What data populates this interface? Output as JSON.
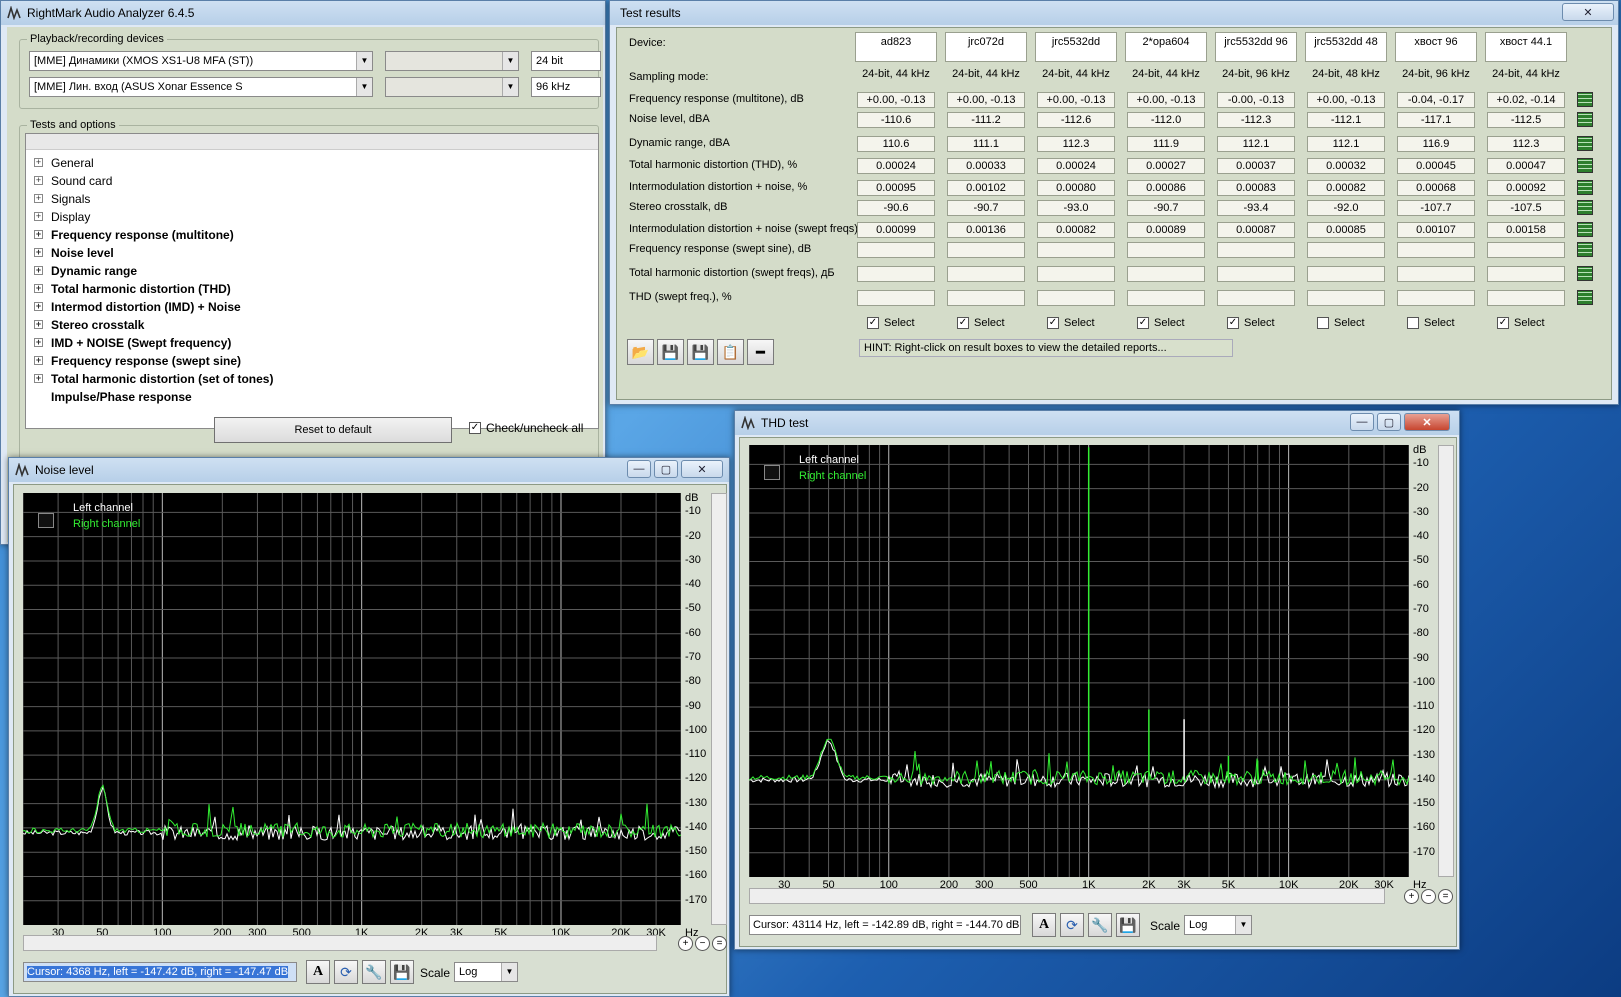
{
  "main": {
    "title": "RightMark Audio Analyzer 6.4.5",
    "playback_group": "Playback/recording devices",
    "playback_device": "[MME] Динамики (XMOS XS1-U8 MFA (ST))",
    "record_device": "[MME] Лин. вход (ASUS Xonar Essence S",
    "bits": "24 bit",
    "rate": "96 kHz",
    "tests_group": "Tests and options",
    "tree": [
      "General",
      "Sound card",
      "Signals",
      "Display",
      "Frequency response (multitone)",
      "Noise level",
      "Dynamic range",
      "Total harmonic distortion (THD)",
      "Intermod distortion (IMD) + Noise",
      "Stereo crosstalk",
      "IMD + NOISE (Swept frequency)",
      "Frequency response (swept sine)",
      "Total harmonic distortion (set of tones)",
      "Impulse/Phase response"
    ],
    "reset": "Reset to default",
    "checkall": "Check/uncheck all"
  },
  "results": {
    "title": "Test results",
    "device_label": "Device:",
    "sampling_label": "Sampling mode:",
    "devices": [
      "ad823",
      "jrc072d",
      "jrc5532dd",
      "2*opa604",
      "jrc5532dd 96",
      "jrc5532dd 48",
      "хвост 96",
      "хвост 44.1"
    ],
    "modes": [
      "24-bit, 44 kHz",
      "24-bit, 44 kHz",
      "24-bit, 44 kHz",
      "24-bit, 44 kHz",
      "24-bit, 96 kHz",
      "24-bit, 48 kHz",
      "24-bit, 96 kHz",
      "24-bit, 44 kHz"
    ],
    "rows": [
      {
        "label": "Frequency response (multitone), dB",
        "values": [
          "+0.00, -0.13",
          "+0.00, -0.13",
          "+0.00, -0.13",
          "+0.00, -0.13",
          "-0.00, -0.13",
          "+0.00, -0.13",
          "-0.04, -0.17",
          "+0.02, -0.14"
        ]
      },
      {
        "label": "Noise level, dBA",
        "values": [
          "-110.6",
          "-111.2",
          "-112.6",
          "-112.0",
          "-112.3",
          "-112.1",
          "-117.1",
          "-112.5"
        ]
      },
      {
        "label": "Dynamic range, dBA",
        "values": [
          "110.6",
          "111.1",
          "112.3",
          "111.9",
          "112.1",
          "112.1",
          "116.9",
          "112.3"
        ]
      },
      {
        "label": "Total harmonic distortion (THD), %",
        "values": [
          "0.00024",
          "0.00033",
          "0.00024",
          "0.00027",
          "0.00037",
          "0.00032",
          "0.00045",
          "0.00047"
        ]
      },
      {
        "label": "Intermodulation distortion + noise, %",
        "values": [
          "0.00095",
          "0.00102",
          "0.00080",
          "0.00086",
          "0.00083",
          "0.00082",
          "0.00068",
          "0.00092"
        ]
      },
      {
        "label": "Stereo crosstalk, dB",
        "values": [
          "-90.6",
          "-90.7",
          "-93.0",
          "-90.7",
          "-93.4",
          "-92.0",
          "-107.7",
          "-107.5"
        ]
      },
      {
        "label": "Intermodulation distortion + noise (swept freqs), %",
        "values": [
          "0.00099",
          "0.00136",
          "0.00082",
          "0.00089",
          "0.00087",
          "0.00085",
          "0.00107",
          "0.00158"
        ]
      },
      {
        "label": "Frequency response (swept sine), dB",
        "values": [
          "",
          "",
          "",
          "",
          "",
          "",
          "",
          ""
        ]
      },
      {
        "label": "Total harmonic distortion (swept freqs), дБ",
        "values": [
          "",
          "",
          "",
          "",
          "",
          "",
          "",
          ""
        ]
      },
      {
        "label": "THD (swept freq.), %",
        "values": [
          "",
          "",
          "",
          "",
          "",
          "",
          "",
          ""
        ]
      }
    ],
    "select_label": "Select",
    "selected": [
      true,
      true,
      true,
      true,
      true,
      false,
      false,
      true
    ],
    "hint": "HINT: Right-click on result boxes to view the detailed reports..."
  },
  "noise": {
    "title": "Noise level",
    "left": "Left channel",
    "right": "Right channel",
    "cursor": "Cursor:  4368 Hz,  left = -147.42 dB,  right = -147.47 dB",
    "scale_label": "Scale",
    "scale": "Log"
  },
  "thd": {
    "title": "THD test",
    "left": "Left channel",
    "right": "Right channel",
    "cursor": "Cursor:  43114 Hz,  left = -142.89 dB,  right = -144.70 dB",
    "scale_label": "Scale",
    "scale": "Log"
  },
  "axis": {
    "db_unit": "dB",
    "hz_unit": "Hz",
    "y_ticks": [
      "-10",
      "-20",
      "-30",
      "-40",
      "-50",
      "-60",
      "-70",
      "-80",
      "-90",
      "-100",
      "-110",
      "-120",
      "-130",
      "-140",
      "-150",
      "-160",
      "-170"
    ],
    "x_ticks": [
      "30",
      "50",
      "100",
      "200",
      "300",
      "500",
      "1K",
      "2K",
      "3K",
      "5K",
      "10K",
      "20K",
      "30K"
    ]
  },
  "colors": {
    "left": "#ffffff",
    "right": "#33ee33"
  }
}
